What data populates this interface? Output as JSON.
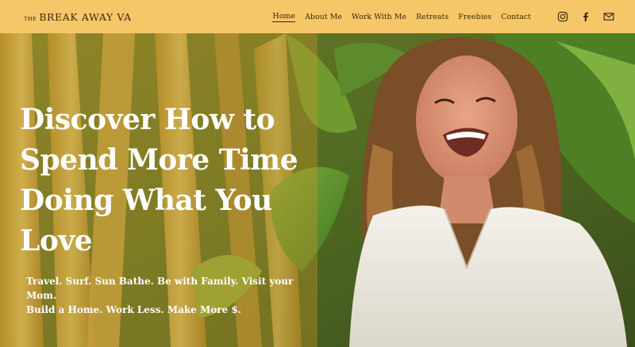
{
  "brand": {
    "prefix": "THE",
    "name": "BREAK AWAY VA"
  },
  "nav": {
    "items": [
      {
        "label": "Home",
        "active": true
      },
      {
        "label": "About Me",
        "active": false
      },
      {
        "label": "Work With Me",
        "active": false
      },
      {
        "label": "Retreats",
        "active": false
      },
      {
        "label": "Freebies",
        "active": false
      },
      {
        "label": "Contact",
        "active": false
      }
    ],
    "social": [
      "instagram-icon",
      "facebook-icon",
      "email-icon"
    ]
  },
  "hero": {
    "title_lines": [
      "Discover How to",
      "Spend More Time",
      "Doing What You",
      "Love"
    ],
    "subtitle_lines": [
      "Travel. Surf. Sun Bathe. Be with Family. Visit your Mom.",
      "Build a Home. Work Less. Make More $."
    ]
  },
  "colors": {
    "header_bg": "#f6c769",
    "text_dark": "#3a2a0a",
    "hero_text": "#ffffff"
  }
}
